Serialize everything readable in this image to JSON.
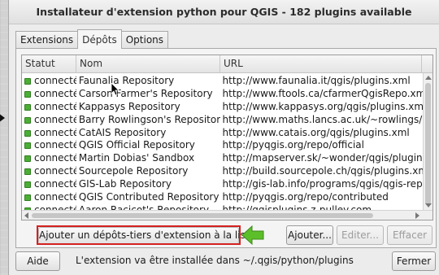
{
  "window": {
    "title": "Installateur d'extension python pour QGIS - 182 plugins available"
  },
  "tabs": [
    {
      "label": "Extensions",
      "active": false
    },
    {
      "label": "Dépôts",
      "active": true
    },
    {
      "label": "Options",
      "active": false
    }
  ],
  "table": {
    "headers": [
      "Statut",
      "Nom",
      "URL"
    ],
    "rows": [
      {
        "status": "connecté",
        "name": "Faunalia Repository",
        "url": "http://www.faunalia.it/qgis/plugins.xml"
      },
      {
        "status": "connecté",
        "name": "Carson Farmer's Repository",
        "url": "http://www.ftools.ca/cfarmerQgisRepo.xml"
      },
      {
        "status": "connecté",
        "name": "Kappasys Repository",
        "url": "http://www.kappasys.org/qgis/plugins.xml"
      },
      {
        "status": "connecté",
        "name": "Barry Rowlingson's Repository",
        "url": "http://www.maths.lancs.ac.uk/~rowlings/Qgis/P"
      },
      {
        "status": "connecté",
        "name": "CatAIS Repository",
        "url": "http://www.catais.org/qgis/plugins.xml"
      },
      {
        "status": "connecté",
        "name": "QGIS Official Repository",
        "url": "http://pyqgis.org/repo/official"
      },
      {
        "status": "connecté",
        "name": "Martin Dobias' Sandbox",
        "url": "http://mapserver.sk/~wonder/qgis/plugins-sand"
      },
      {
        "status": "connecté",
        "name": "Sourcepole Repository",
        "url": "http://build.sourcepole.ch/qgis/plugins.xml"
      },
      {
        "status": "connecté",
        "name": "GIS-Lab Repository",
        "url": "http://gis-lab.info/programs/qgis/qgis-repo.xml"
      },
      {
        "status": "connecté",
        "name": "QGIS Contributed Repository",
        "url": "http://pyqgis.org/repo/contributed"
      },
      {
        "status": "connecté",
        "name": "Aaron Racicot's Repository",
        "url": "http://qgisplugins.z-pulley.com"
      }
    ]
  },
  "buttons": {
    "add_third_party": "Ajouter un dépôts-tiers d'extension à la liste",
    "add": "Ajouter...",
    "edit": "Editer...",
    "delete": "Effacer",
    "help": "Aide",
    "close": "Fermer"
  },
  "status_message": "L'extension va être installée dans ~/.qgis/python/plugins",
  "colors": {
    "connected_indicator": "#4caf35",
    "highlight_box": "#d42121",
    "arrow_green": "#5cbf2a"
  }
}
